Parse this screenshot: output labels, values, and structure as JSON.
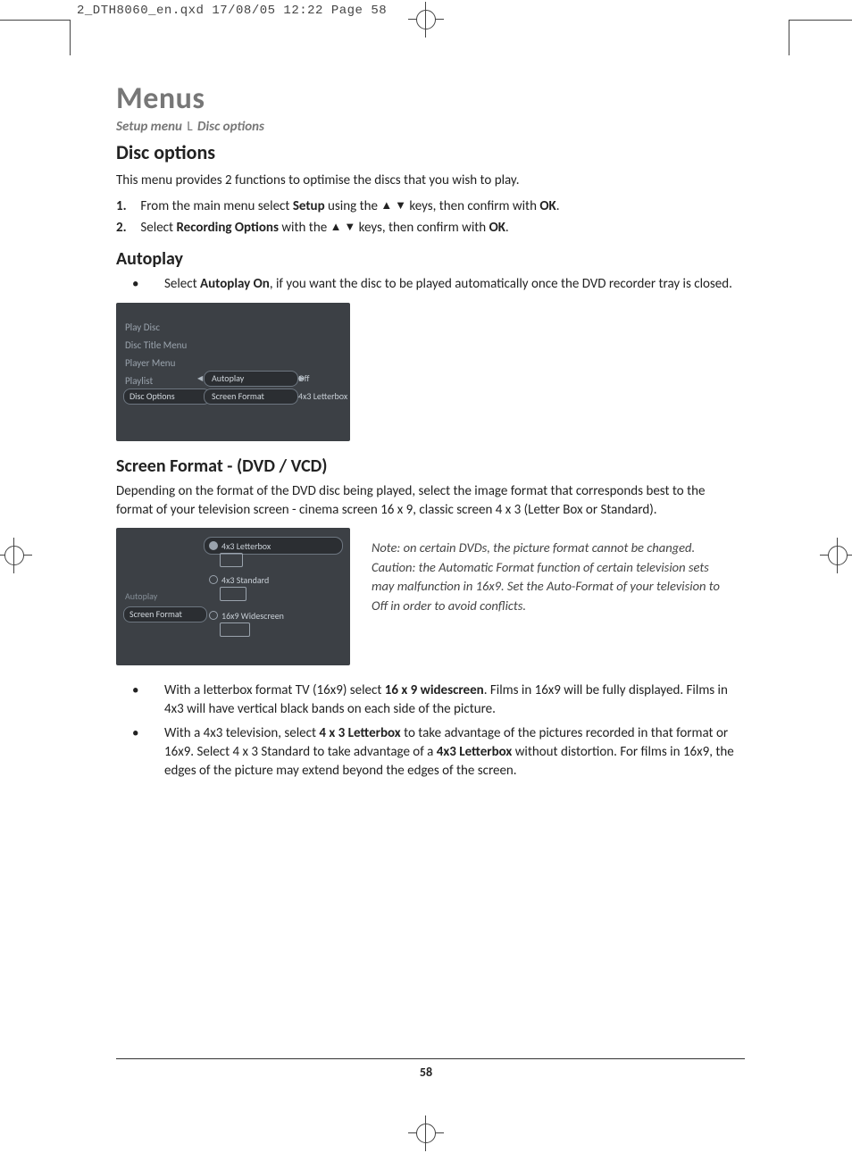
{
  "print_header": "2_DTH8060_en.qxd  17/08/05  12:22  Page 58",
  "title": "Menus",
  "breadcrumb": {
    "a": "Setup menu",
    "sep": "L",
    "b": "Disc options"
  },
  "h_disc_options": "Disc options",
  "intro": "This menu provides 2 functions to optimise the discs that you wish to play.",
  "steps": {
    "s1": {
      "n": "1.",
      "pre": "From the main menu select ",
      "b1": "Setup",
      "mid": " using the  ",
      "arrows": "▲  ▼",
      "post": " keys, then confirm with ",
      "ok": "OK",
      "end": "."
    },
    "s2": {
      "n": "2.",
      "pre": "Select ",
      "b1": "Recording Options",
      "mid": " with the  ",
      "arrows": "▲  ▼",
      "post": "  keys, then confirm with ",
      "ok": "OK",
      "end": "."
    }
  },
  "h_autoplay": "Autoplay",
  "autoplay_bullet": {
    "pre": "Select ",
    "b": "Autoplay On",
    "post": ", if you want the disc to be played automatically once the DVD recorder tray is closed."
  },
  "shot1": {
    "menu": [
      "Play Disc",
      "Disc Title Menu",
      "Player Menu",
      "Playlist"
    ],
    "highlight": "Disc Options",
    "opt_a": "Autoplay",
    "val_a": "Off",
    "opt_b": "Screen Format",
    "val_b": "4x3 Letterbox"
  },
  "h_screen_format": "Screen Format - (DVD / VCD)",
  "sf_intro": "Depending on the format of the DVD disc being played, select the image format that corresponds best to the format of your television screen - cinema screen 16 x 9, classic screen 4 x 3 (Letter Box or Standard).",
  "shot2": {
    "left_a": "Autoplay",
    "left_b": "Screen Format",
    "r1": "4x3 Letterbox",
    "r2": "4x3 Standard",
    "r3": "16x9 Widescreen"
  },
  "note": "Note: on certain DVDs, the picture format cannot be changed. Caution: the Automatic Format function of certain television sets may malfunction in 16x9. Set the Auto-Format of your television to Off in order to avoid conflicts.",
  "sf_bullets": {
    "b1": {
      "pre": "With a letterbox format TV (16x9) select ",
      "b": "16 x 9 widescreen",
      "post": ". Films in 16x9 will be fully displayed. Films in 4x3 will have vertical black bands on each side of the picture."
    },
    "b2": {
      "pre": "With a 4x3 television, select ",
      "b1": "4 x 3 Letterbox",
      "mid": " to take advantage of the pictures recorded in that format or 16x9. Select 4 x 3 Standard to take advantage of a ",
      "b2": "4x3 Letterbox",
      "post": " without distortion. For films in 16x9, the edges of the picture may extend beyond the edges of the screen."
    }
  },
  "page_number": "58"
}
